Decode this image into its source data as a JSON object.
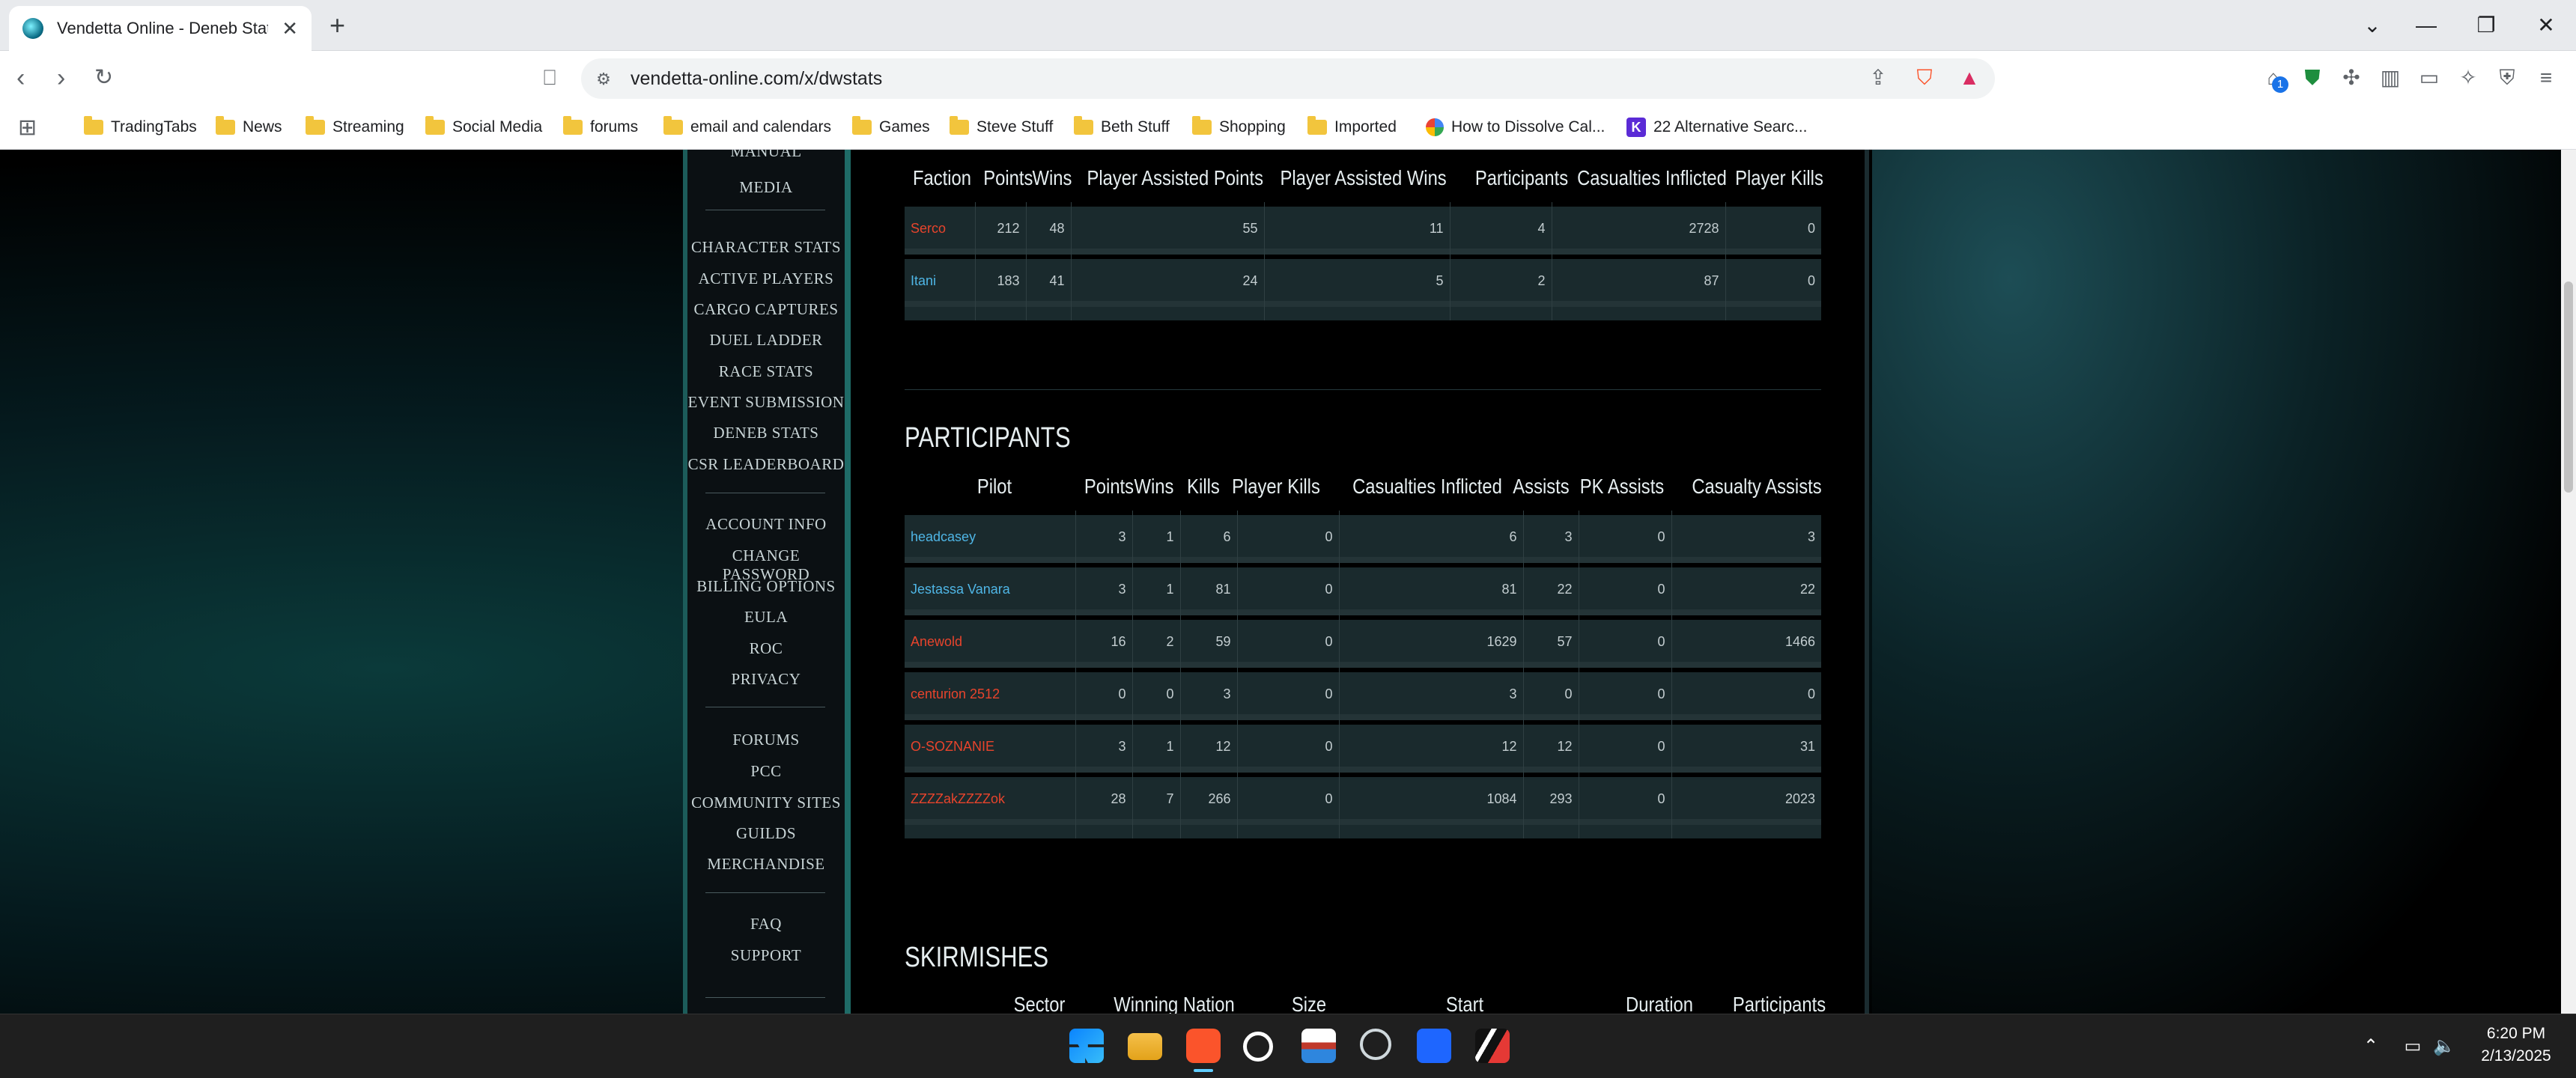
{
  "browser": {
    "tab_title": "Vendetta Online - Deneb Stats",
    "url": "vendetta-online.com/x/dwstats",
    "bookmarks": [
      "TradingTabs",
      "News",
      "Streaming",
      "Social Media",
      "forums",
      "email and calendars",
      "Games",
      "Steve Stuff",
      "Beth Stuff",
      "Shopping",
      "Imported",
      "How to Dissolve Cal...",
      "22 Alternative Searc..."
    ],
    "notification_count": "1"
  },
  "sidebar": {
    "items": [
      "MANUAL",
      "MEDIA",
      "CHARACTER STATS",
      "ACTIVE PLAYERS",
      "CARGO CAPTURES",
      "DUEL LADDER",
      "RACE STATS",
      "EVENT SUBMISSION",
      "DENEB STATS",
      "CSR LEADERBOARD",
      "ACCOUNT INFO",
      "CHANGE PASSWORD",
      "BILLING OPTIONS",
      "EULA",
      "ROC",
      "PRIVACY",
      "FORUMS",
      "PCC",
      "COMMUNITY SITES",
      "GUILDS",
      "MERCHANDISE",
      "FAQ",
      "SUPPORT"
    ]
  },
  "factions": {
    "headers": [
      "Faction",
      "Points",
      "Wins",
      "Player Assisted Points",
      "Player Assisted Wins",
      "Participants",
      "Casualties Inflicted",
      "Player Kills"
    ],
    "rows": [
      [
        "Serco",
        "212",
        "48",
        "55",
        "11",
        "4",
        "2728",
        "0"
      ],
      [
        "Itani",
        "183",
        "41",
        "24",
        "5",
        "2",
        "87",
        "0"
      ]
    ],
    "row_colors": [
      "#e8442c",
      "#4fb6e6"
    ]
  },
  "participants": {
    "title": "PARTICIPANTS",
    "headers": [
      "Pilot",
      "Points",
      "Wins",
      "Kills",
      "Player Kills",
      "Casualties Inflicted",
      "Assists",
      "PK Assists",
      "Casualty Assists"
    ],
    "rows": [
      [
        "headcasey",
        "3",
        "1",
        "6",
        "0",
        "6",
        "3",
        "0",
        "3"
      ],
      [
        "Jestassa Vanara",
        "3",
        "1",
        "81",
        "0",
        "81",
        "22",
        "0",
        "22"
      ],
      [
        "Anewold",
        "16",
        "2",
        "59",
        "0",
        "1629",
        "57",
        "0",
        "1466"
      ],
      [
        "centurion 2512",
        "0",
        "0",
        "3",
        "0",
        "3",
        "0",
        "0",
        "0"
      ],
      [
        "O-SOZNANIE",
        "3",
        "1",
        "12",
        "0",
        "12",
        "12",
        "0",
        "31"
      ],
      [
        "ZZZZakZZZZok",
        "28",
        "7",
        "266",
        "0",
        "1084",
        "293",
        "0",
        "2023"
      ]
    ],
    "row_colors": [
      "#4fb6e6",
      "#4fb6e6",
      "#e8442c",
      "#e8442c",
      "#e8442c",
      "#e8442c"
    ]
  },
  "skirmishes": {
    "title": "SKIRMISHES",
    "headers": [
      "Sector",
      "Winning Nation",
      "Size",
      "Start",
      "Duration",
      "Participants"
    ]
  },
  "taskbar": {
    "time": "6:20 PM",
    "date": "2/13/2025"
  }
}
